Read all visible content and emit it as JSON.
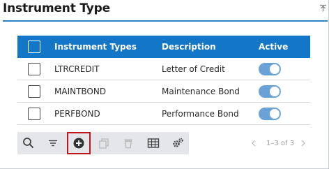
{
  "panel": {
    "title": "Instrument Type",
    "collapse_icon": "collapse-up-icon"
  },
  "grid": {
    "columns": {
      "type": "Instrument Types",
      "description": "Description",
      "active": "Active"
    },
    "rows": [
      {
        "type": "LTRCREDIT",
        "description": "Letter of Credit",
        "active": true
      },
      {
        "type": "MAINTBOND",
        "description": "Maintenance Bond",
        "active": true
      },
      {
        "type": "PERFBOND",
        "description": "Performance Bond",
        "active": true
      }
    ]
  },
  "toolbar": {
    "buttons": [
      "search-icon",
      "filter-icon",
      "add-icon",
      "copy-icon",
      "delete-icon",
      "columns-icon",
      "settings-icon"
    ],
    "highlighted": "add-icon"
  },
  "pager": {
    "range": "1–3 of 3"
  },
  "colors": {
    "header_bg": "#1476c6",
    "accent": "#2f80c3",
    "toggle_on": "#6aa2d8",
    "highlight_border": "#c0161e"
  }
}
